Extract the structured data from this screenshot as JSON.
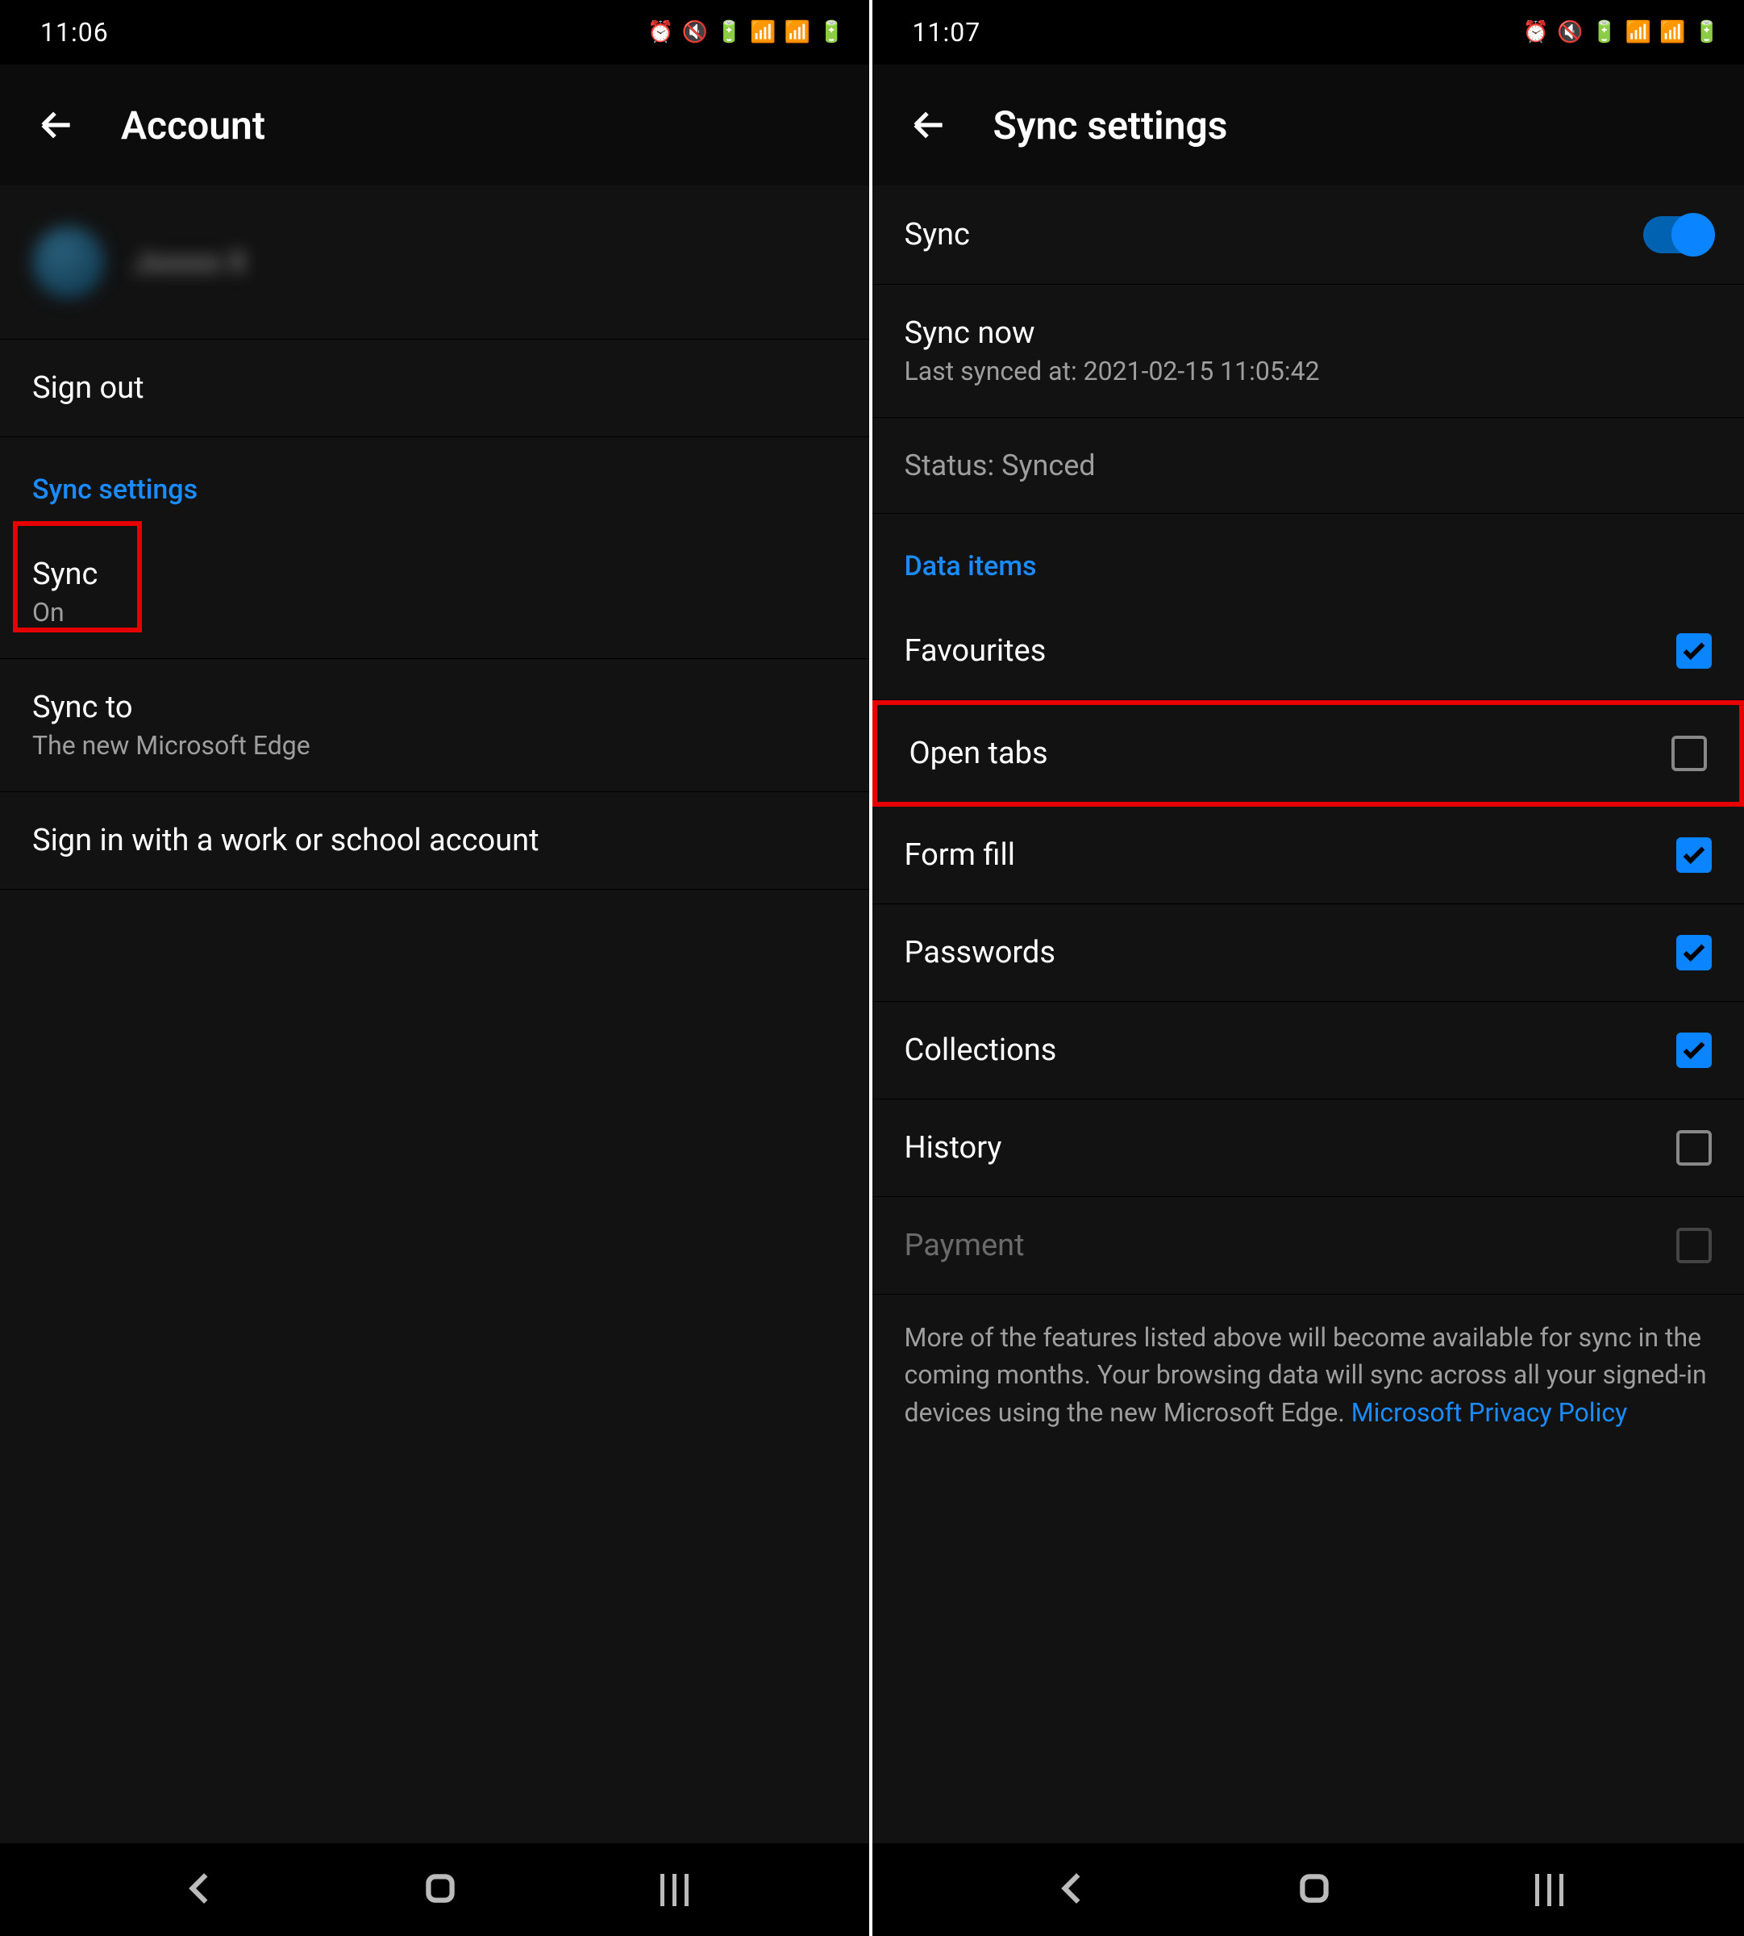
{
  "left": {
    "status": {
      "time": "11:06"
    },
    "header": {
      "title": "Account"
    },
    "account": {
      "name": "Jxxxxx X"
    },
    "rows": {
      "signout": "Sign out",
      "sync_settings_header": "Sync settings",
      "sync": {
        "title": "Sync",
        "sub": "On"
      },
      "sync_to": {
        "title": "Sync to",
        "sub": "The new Microsoft Edge"
      },
      "signin_work": "Sign in with a work or school account"
    }
  },
  "right": {
    "status": {
      "time": "11:07"
    },
    "header": {
      "title": "Sync settings"
    },
    "sync_toggle": {
      "label": "Sync",
      "on": true
    },
    "sync_now": {
      "title": "Sync now",
      "sub": "Last synced at: 2021-02-15 11:05:42"
    },
    "status_row": "Status: Synced",
    "data_items_header": "Data items",
    "items": [
      {
        "label": "Favourites",
        "checked": true
      },
      {
        "label": "Open tabs",
        "checked": false,
        "highlight": true
      },
      {
        "label": "Form fill",
        "checked": true
      },
      {
        "label": "Passwords",
        "checked": true
      },
      {
        "label": "Collections",
        "checked": true
      },
      {
        "label": "History",
        "checked": false
      },
      {
        "label": "Payment",
        "checked": false,
        "disabled": true
      }
    ],
    "footer": {
      "text": "More of the features listed above will become available for sync in the coming months. Your browsing data will sync across all your signed-in devices using the new Microsoft Edge. ",
      "link": "Microsoft Privacy Policy"
    }
  }
}
